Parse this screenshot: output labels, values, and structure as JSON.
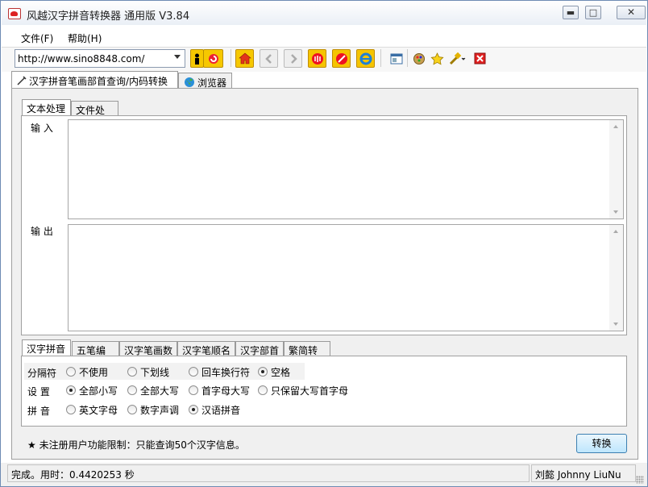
{
  "window": {
    "title": "风越汉字拼音转换器 通用版 V3.84",
    "minimize": "▬",
    "maximize": "□",
    "close": "✕"
  },
  "menu": {
    "file": "文件(F)",
    "help": "帮助(H)"
  },
  "toolbar": {
    "url": "http://www.sino8848.com/",
    "icons": [
      "person-icon",
      "refresh-icon",
      "home-icon",
      "back-icon",
      "forward-icon",
      "reload-icon",
      "stop-icon",
      "ie-icon",
      "window-icon",
      "palette-icon",
      "star-icon",
      "tools-icon",
      "close-red-icon"
    ]
  },
  "outer_tabs": [
    "汉字拼音笔画部首查询/内码转换",
    "浏览器"
  ],
  "inner_tabs": [
    "文本处理",
    "文件处理"
  ],
  "labels": {
    "input": "输 入",
    "output": "输 出"
  },
  "option_tabs": [
    "汉字拼音",
    "五笔编码",
    "汉字笔画数",
    "汉字笔顺名",
    "汉字部首",
    "繁简转换"
  ],
  "options": {
    "separator": {
      "label": "分隔符",
      "choices": [
        "不使用",
        "下划线",
        "回车换行符",
        "空格"
      ],
      "selected": 3
    },
    "setting": {
      "label": "设 置",
      "choices": [
        "全部小写",
        "全部大写",
        "首字母大写",
        "只保留大写首字母"
      ],
      "selected": 0
    },
    "pinyin": {
      "label": "拼 音",
      "choices": [
        "英文字母",
        "数字声调",
        "汉语拼音"
      ],
      "selected": 2
    }
  },
  "notice": "★ 未注册用户功能限制：只能查询50个汉字信息。",
  "convert_button": "转换",
  "status": {
    "left": "完成。用时：0.4420253 秒",
    "right": "刘懿 Johnny LiuNu"
  },
  "colors": {
    "accent": "#3c7fb1",
    "border": "#a0a0a0",
    "titlebar": "#eaeff6"
  }
}
